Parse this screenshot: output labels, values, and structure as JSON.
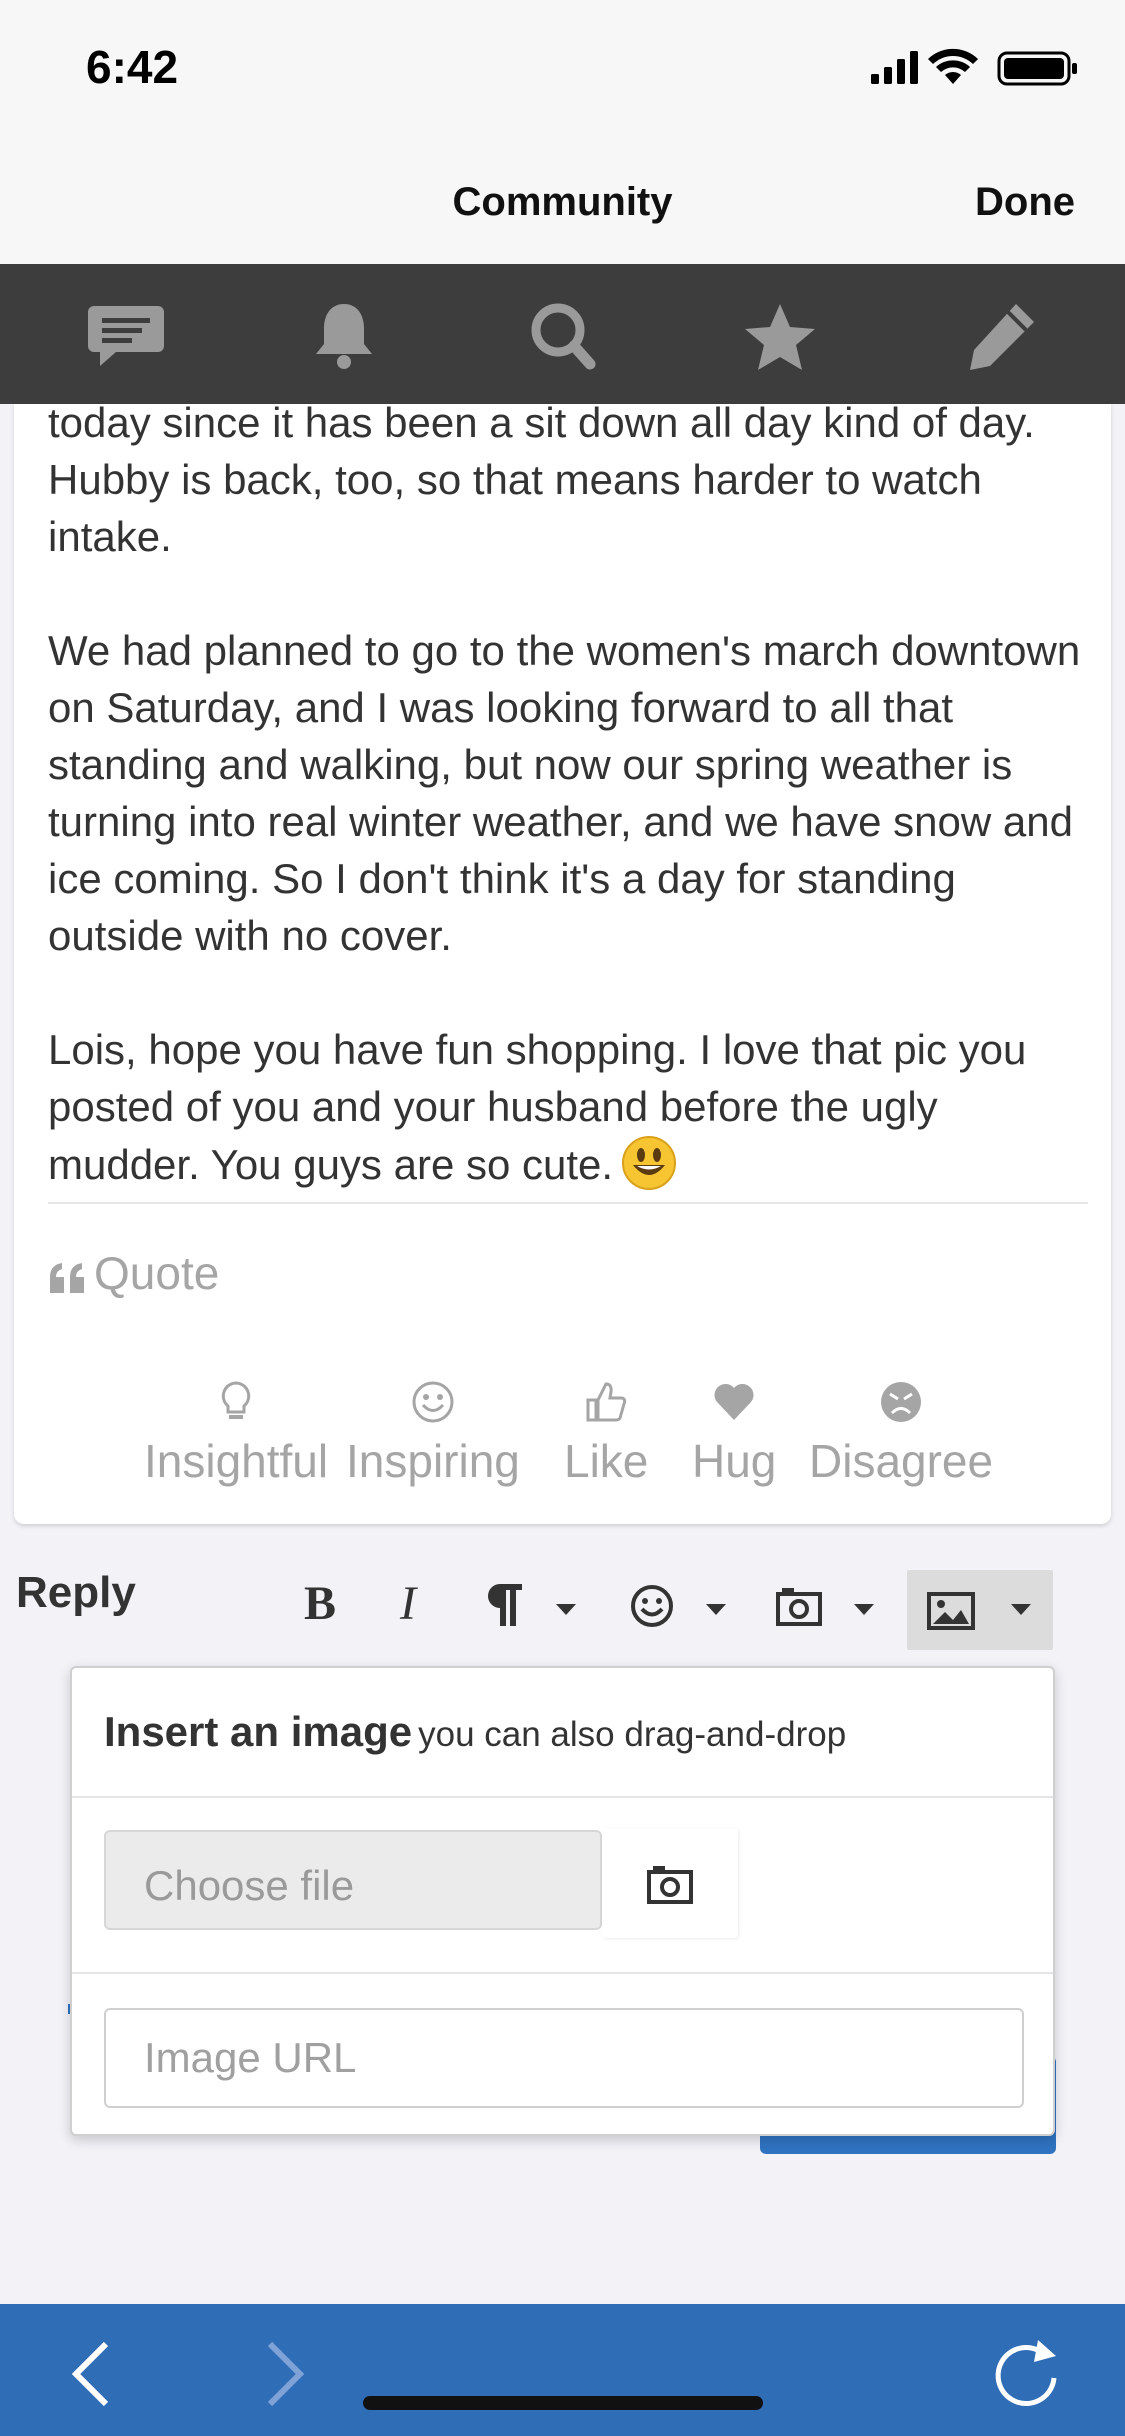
{
  "status_bar": {
    "time": "6:42"
  },
  "nav": {
    "title": "Community",
    "done_label": "Done"
  },
  "toolbar": {
    "icons": [
      "conversations-icon",
      "bell-icon",
      "search-icon",
      "star-icon",
      "pencil-icon"
    ]
  },
  "post": {
    "paragraphs": [
      "today since it has been a sit down all day kind of day. Hubby is back, too, so that means harder to watch intake.",
      "We had planned to go to the women's march downtown on Saturday, and I was looking forward to all that standing and walking, but now our spring weather is turning into real winter weather, and we have snow and ice coming. So I don't think it's a day for standing outside with no cover.",
      "Lois, hope you have fun shopping. I love that pic you posted of you and your husband before the ugly mudder. You guys are so cute."
    ],
    "quote_label": "Quote",
    "reactions": [
      "Insightful",
      "Inspiring",
      "Like",
      "Hug",
      "Disagree"
    ]
  },
  "reply": {
    "label": "Reply",
    "bold_label": "B",
    "italic_label": "I"
  },
  "image_popup": {
    "title": "Insert an image",
    "subtitle": "you can also drag-and-drop",
    "choose_file_label": "Choose file",
    "url_placeholder": "Image URL"
  },
  "colors": {
    "toolbar_bg": "#3d3d3d",
    "accent_blue": "#2f6db6",
    "muted_text": "#a5a5a5"
  }
}
